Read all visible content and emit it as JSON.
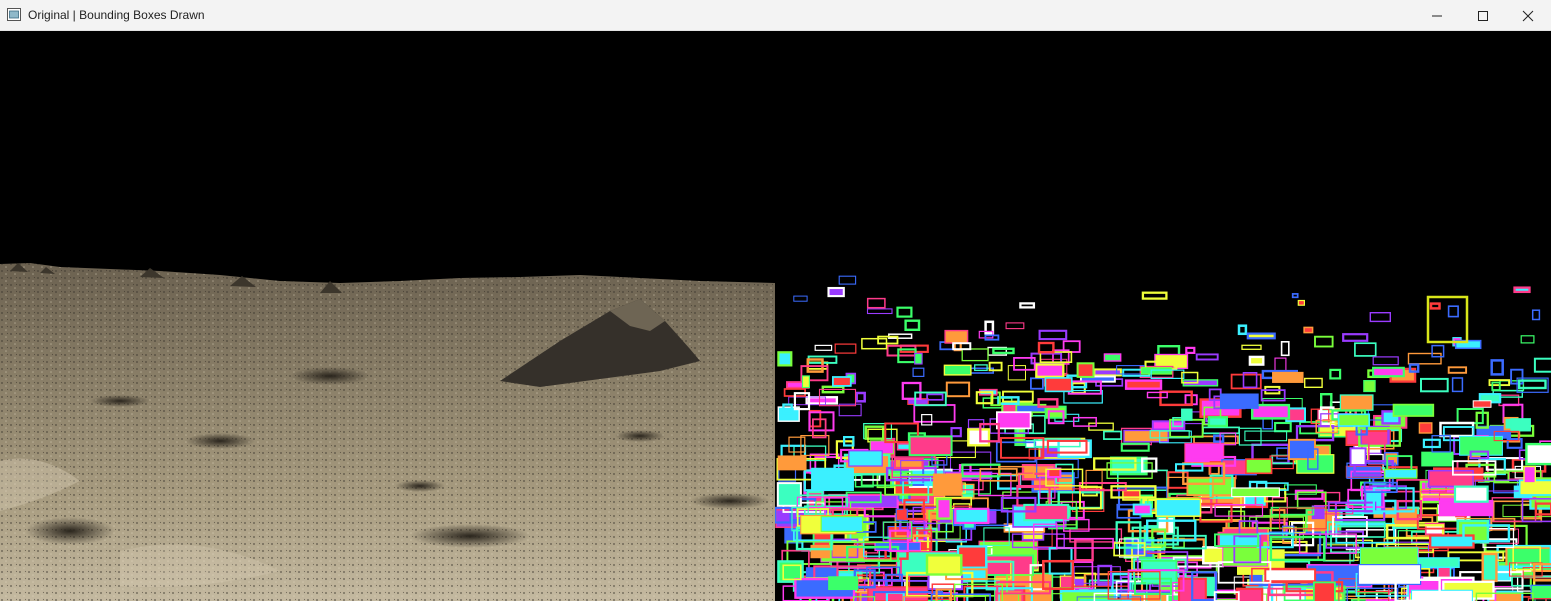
{
  "window": {
    "title": "Original | Bounding Boxes Drawn",
    "controls": [
      "minimize",
      "maximize",
      "close"
    ],
    "icons": {
      "app": "window-app-icon",
      "minimize": "minimize-icon",
      "maximize": "maximize-icon",
      "close": "close-icon"
    }
  },
  "panels": {
    "left": {
      "content": "lunar-surface-photo"
    },
    "right": {
      "content": "bounding-box-detections"
    }
  },
  "colors": {
    "titlebar": "#f3f3f3",
    "background": "#000000",
    "regolith_light": "#b9ad92",
    "regolith_dark": "#4a4236",
    "highlight_box": "#d9e61a"
  }
}
